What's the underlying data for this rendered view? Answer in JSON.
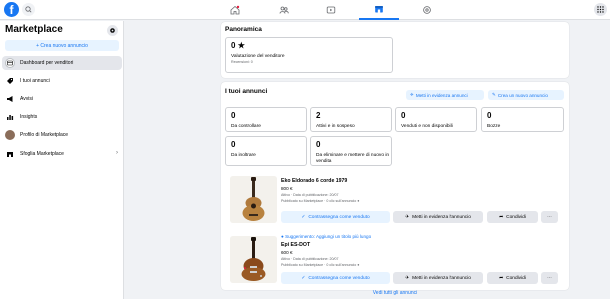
{
  "nav": {
    "logo": "f",
    "tabs": [
      "home-icon",
      "groups-icon",
      "watch-icon",
      "marketplace-icon",
      "gaming-icon"
    ]
  },
  "sidebar": {
    "title": "Marketplace",
    "create_label": "+ Crea nuovo annuncio",
    "items": [
      {
        "label": "Dashboard per venditori",
        "icon": "dashboard-icon"
      },
      {
        "label": "I tuoi annunci",
        "icon": "tag-icon"
      },
      {
        "label": "Avvisi",
        "icon": "megaphone-icon"
      },
      {
        "label": "Insights",
        "icon": "chart-icon"
      },
      {
        "label": "Profilo di Marketplace",
        "icon": "avatar-icon"
      },
      {
        "label": "Sfoglia Marketplace",
        "icon": "shop-icon"
      }
    ]
  },
  "overview": {
    "title": "Panoramica",
    "rating_value": "0",
    "rating_label": "Valutazione del venditore",
    "reviews": "Recensioni: 0"
  },
  "listings": {
    "title": "I tuoi annunci",
    "promote_btn": "Metti in evidenza annunci",
    "create_btn": "Crea un nuovo annuncio",
    "stats": [
      {
        "num": "0",
        "label": "Da controllare"
      },
      {
        "num": "2",
        "label": "Attivi e in sospeso"
      },
      {
        "num": "0",
        "label": "Venduti e non disponibili"
      },
      {
        "num": "0",
        "label": "Bozze"
      },
      {
        "num": "0",
        "label": "Da inoltrare"
      },
      {
        "num": "0",
        "label": "Da eliminare e mettere di nuovo in vendita"
      }
    ],
    "items": [
      {
        "title": "Eko Eldorado 6 corde 1979",
        "price": "800 €",
        "meta1": "Attivo · Data di pubblicazione: 20/07",
        "meta2": "Pubblicato su Marketplace · 0 clic sull'annuncio",
        "sold_btn": "Contrassegna come venduto",
        "promote_btn": "Metti in evidenza l'annuncio",
        "share_btn": "Condividi",
        "more_btn": "···"
      },
      {
        "suggestion": "Suggerimento: Aggiungi un titolo più lungo",
        "title": "Epi ES-DOT",
        "price": "600 €",
        "meta1": "Attivo · Data di pubblicazione: 20/07",
        "meta2": "Pubblicato su Marketplace · 0 clic sull'annuncio",
        "sold_btn": "Contrassegna come venduto",
        "promote_btn": "Metti in evidenza l'annuncio",
        "share_btn": "Condividi",
        "more_btn": "···"
      }
    ],
    "see_all": "Vedi tutti gli annunci"
  },
  "colors": {
    "accent": "#1877f2",
    "bg": "#f0f2f5",
    "notification": "#e41e3f"
  }
}
